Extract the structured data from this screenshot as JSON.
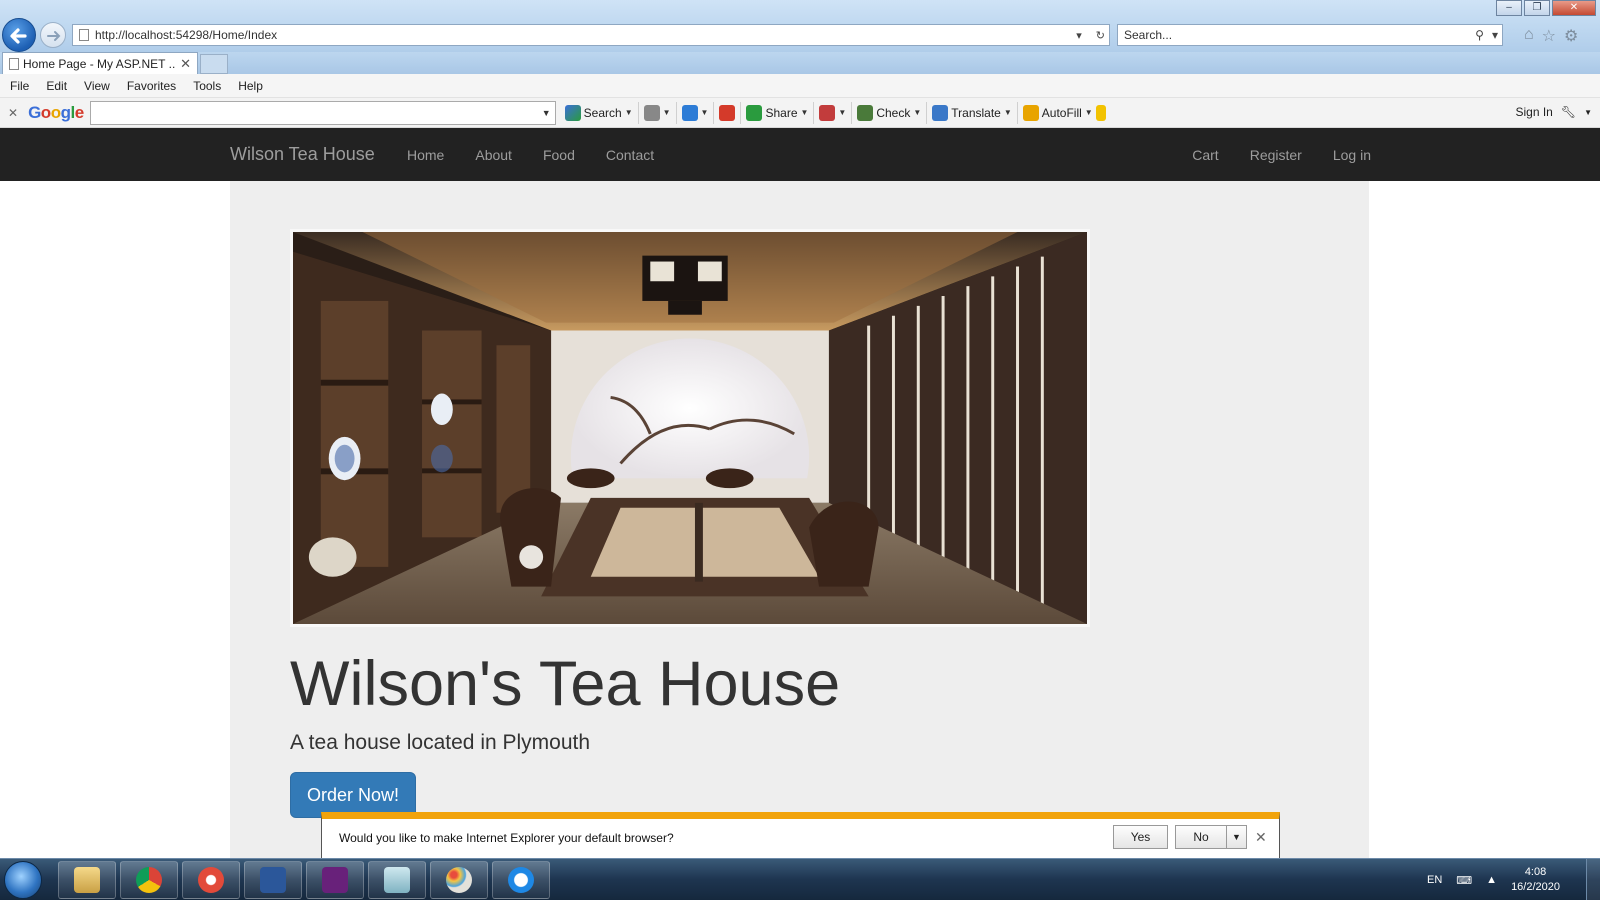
{
  "browser": {
    "address_url": "http://localhost:54298/Home/Index",
    "search_placeholder": "Search...",
    "tab_title": "Home Page - My ASP.NET ...",
    "menu": [
      "File",
      "Edit",
      "View",
      "Favorites",
      "Tools",
      "Help"
    ],
    "google_toolbar": {
      "search_label": "Search",
      "share_label": "Share",
      "check_label": "Check",
      "translate_label": "Translate",
      "autofill_label": "AutoFill",
      "sign_in_label": "Sign In"
    }
  },
  "site": {
    "brand": "Wilson Tea House",
    "nav_left": [
      "Home",
      "About",
      "Food",
      "Contact"
    ],
    "nav_right": [
      "Cart",
      "Register",
      "Log in"
    ],
    "hero_title": "Wilson's Tea House",
    "hero_subtitle": "A tea house located in Plymouth",
    "order_button": "Order Now!"
  },
  "notification": {
    "message": "Would you like to make Internet Explorer your default browser?",
    "yes_label": "Yes",
    "no_label": "No"
  },
  "taskbar": {
    "language": "EN",
    "time": "4:08",
    "date": "16/2/2020",
    "apps": [
      "windows-explorer",
      "google-chrome",
      "chrome-app",
      "microsoft-word",
      "visual-studio",
      "app-generic",
      "paint",
      "internet-explorer"
    ]
  },
  "colors": {
    "site_nav_bg": "#222222",
    "jumbotron_bg": "#eeeeee",
    "primary_button": "#337ab7",
    "notification_accent": "#f1a30c"
  }
}
